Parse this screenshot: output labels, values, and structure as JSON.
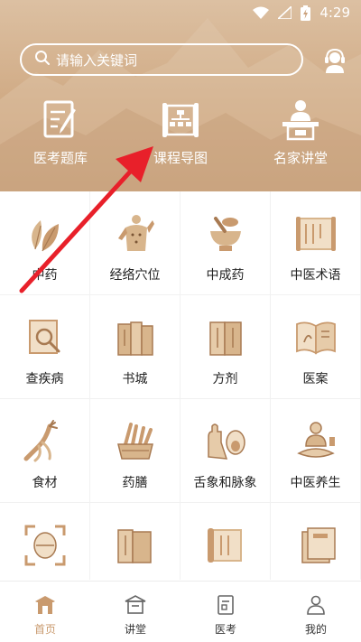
{
  "status_bar": {
    "time": "4:29"
  },
  "search": {
    "placeholder": "请输入关键词"
  },
  "top_shortcuts": [
    {
      "label": "医考题库",
      "icon": "exam-bank-icon"
    },
    {
      "label": "课程导图",
      "icon": "course-map-scroll-icon"
    },
    {
      "label": "名家讲堂",
      "icon": "lecturer-podium-icon"
    }
  ],
  "grid": [
    {
      "label": "中药",
      "icon": "herb-leaves-icon"
    },
    {
      "label": "经络穴位",
      "icon": "acupoint-body-icon"
    },
    {
      "label": "中成药",
      "icon": "mortar-bowl-icon"
    },
    {
      "label": "中医术语",
      "icon": "scroll-icon"
    },
    {
      "label": "查疾病",
      "icon": "disease-search-book-icon"
    },
    {
      "label": "书城",
      "icon": "books-icon"
    },
    {
      "label": "方剂",
      "icon": "prescription-books-icon"
    },
    {
      "label": "医案",
      "icon": "open-book-icon"
    },
    {
      "label": "食材",
      "icon": "ginseng-root-icon"
    },
    {
      "label": "药膳",
      "icon": "herb-basket-icon"
    },
    {
      "label": "舌象和脉象",
      "icon": "tongue-pulse-icon"
    },
    {
      "label": "中医养生",
      "icon": "meditating-figure-icon"
    },
    {
      "label": "",
      "icon": "scan-frame-icon"
    },
    {
      "label": "",
      "icon": "books-icon"
    },
    {
      "label": "",
      "icon": "open-scroll-icon"
    },
    {
      "label": "",
      "icon": "booklet-icon"
    }
  ],
  "bottom_nav": [
    {
      "label": "首页",
      "icon": "home-pavilion-icon",
      "active": true
    },
    {
      "label": "讲堂",
      "icon": "lecture-hall-icon",
      "active": false
    },
    {
      "label": "医考",
      "icon": "exam-doc-icon",
      "active": false
    },
    {
      "label": "我的",
      "icon": "profile-icon",
      "active": false
    }
  ],
  "colors": {
    "header_top": "#dcc0a2",
    "header_bottom": "#c79c74",
    "accent": "#c99a6e",
    "annotation_arrow": "#e8202a"
  }
}
